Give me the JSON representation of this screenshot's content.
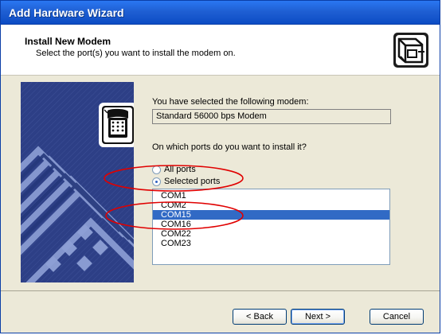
{
  "window": {
    "title": "Add Hardware Wizard"
  },
  "header": {
    "title": "Install New Modem",
    "subtitle": "Select the port(s) you want to install the modem on.",
    "icon": "hardware-wizard-icon"
  },
  "left_panel": {
    "icon": "telephone-modem-icon",
    "colors": {
      "background": "#2d3f86",
      "stripes": "#8fa0d2",
      "icon_border": "#ffffff"
    }
  },
  "content": {
    "selected_model_label": "You have selected the following modem:",
    "selected_model_value": "Standard 56000 bps Modem",
    "ports_question": "On which ports do you want to install it?",
    "radio_options": [
      {
        "label": "All ports",
        "checked": false
      },
      {
        "label": "Selected ports",
        "checked": true
      }
    ],
    "ports": [
      {
        "label": "COM1",
        "selected": false
      },
      {
        "label": "COM2",
        "selected": false
      },
      {
        "label": "COM15",
        "selected": true
      },
      {
        "label": "COM16",
        "selected": false
      },
      {
        "label": "COM22",
        "selected": false
      },
      {
        "label": "COM23",
        "selected": false
      }
    ]
  },
  "footer": {
    "back_label": "< Back",
    "next_label": "Next >",
    "cancel_label": "Cancel"
  },
  "annotations": {
    "highlight_color": "#e00000"
  }
}
